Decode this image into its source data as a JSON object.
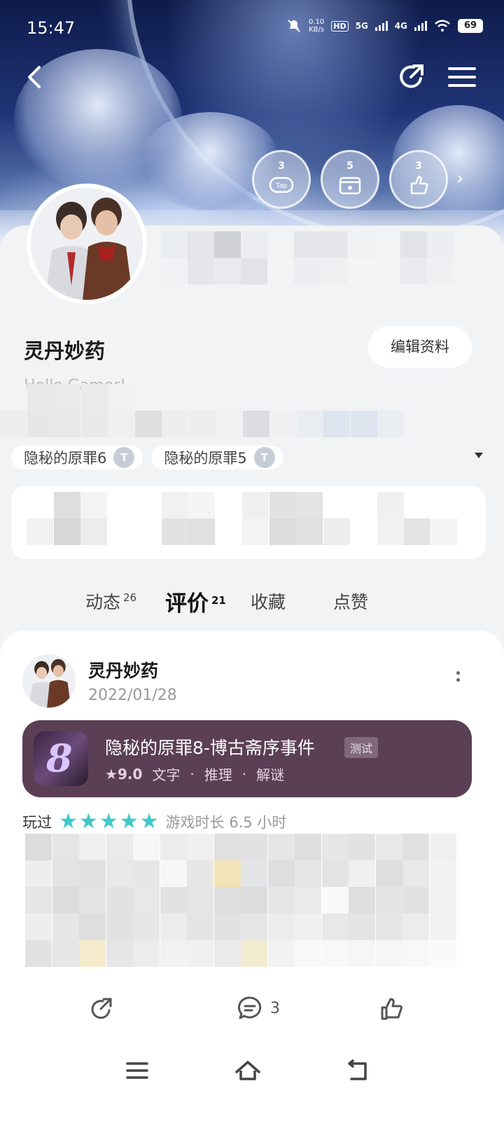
{
  "status_bar": {
    "time": "15:47",
    "net_speed": "0.10\nKB/s",
    "sim1": "5G",
    "sim2": "4G",
    "battery": "69"
  },
  "header": {
    "badges": [
      {
        "count": "3",
        "icon": "tap-controller-icon"
      },
      {
        "count": "5",
        "icon": "calendar-controller-icon"
      },
      {
        "count": "3",
        "icon": "thumbs-up-icon"
      }
    ]
  },
  "profile": {
    "username": "灵丹妙药",
    "edit_label": "编辑资料",
    "bio": "Hello Gamer!",
    "game_tags": [
      {
        "label": "隐秘的原罪6",
        "icon": "T3-badge"
      },
      {
        "label": "隐秘的原罪5",
        "icon": "T3-badge"
      }
    ]
  },
  "tabs": [
    {
      "label": "动态",
      "count": "26"
    },
    {
      "label": "评价",
      "count": "21"
    },
    {
      "label": "收藏",
      "count": ""
    },
    {
      "label": "点赞",
      "count": ""
    }
  ],
  "post": {
    "author": "灵丹妙药",
    "date": "2022/01/28",
    "game": {
      "title": "隐秘的原罪8-博古斋序事件",
      "tag": "测试",
      "score": "9.0",
      "genres": [
        "文字",
        "推理",
        "解谜"
      ]
    },
    "played_label": "玩过",
    "rating": 5,
    "playtime": "游戏时长 6.5 小时",
    "comment_count": "3"
  },
  "colors": {
    "accent": "#14c9c9",
    "game_card_bg": "#5b3f55"
  }
}
